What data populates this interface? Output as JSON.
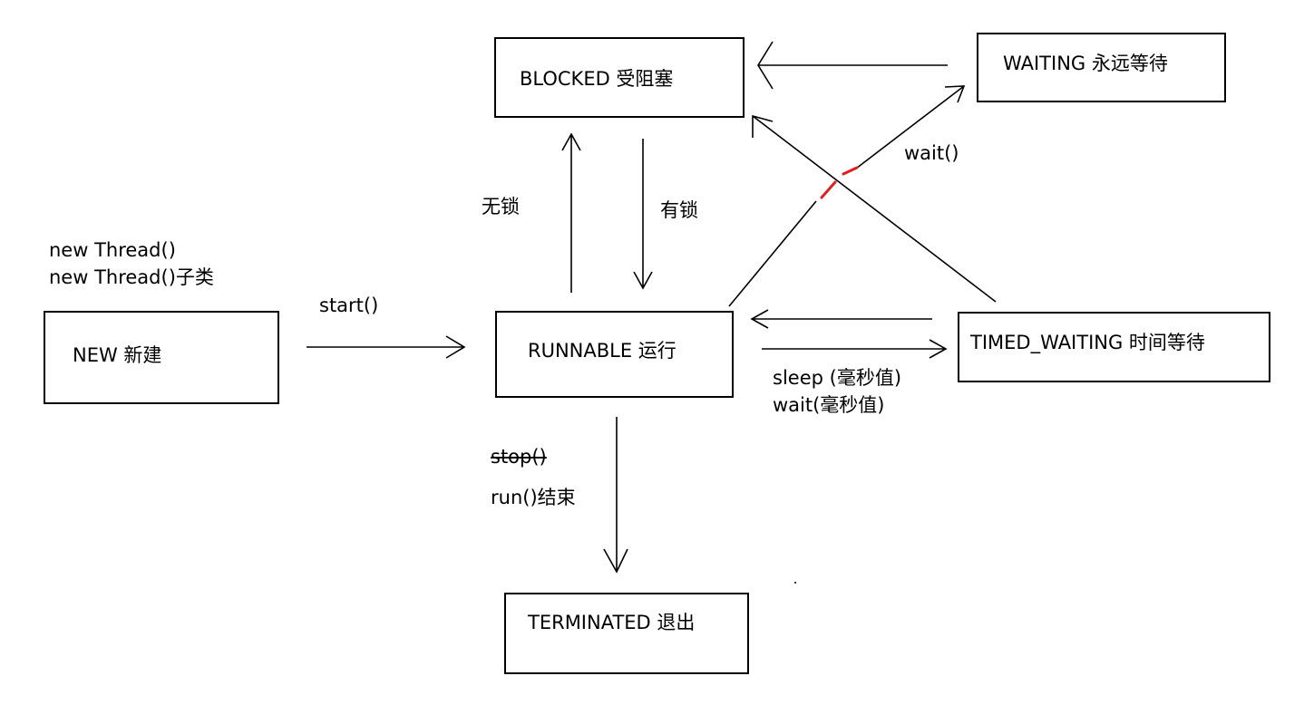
{
  "states": {
    "new": "NEW 新建",
    "runnable": "RUNNABLE 运行",
    "blocked": "BLOCKED 受阻塞",
    "waiting": "WAITING 永远等待",
    "timed_waiting": "TIMED_WAITING 时间等待",
    "terminated": "TERMINATED 退出"
  },
  "creation_notes": [
    "new Thread()",
    "new Thread()子类"
  ],
  "edges": {
    "start": "start()",
    "no_lock": "无锁",
    "has_lock": "有锁",
    "wait": "wait()",
    "sleep": "sleep (毫秒值)",
    "wait_ms": "wait(毫秒值)",
    "stop": "stop()",
    "run_end": "run()结束"
  },
  "colors": {
    "stroke": "#000000",
    "crossing_mark": "#e02020"
  }
}
